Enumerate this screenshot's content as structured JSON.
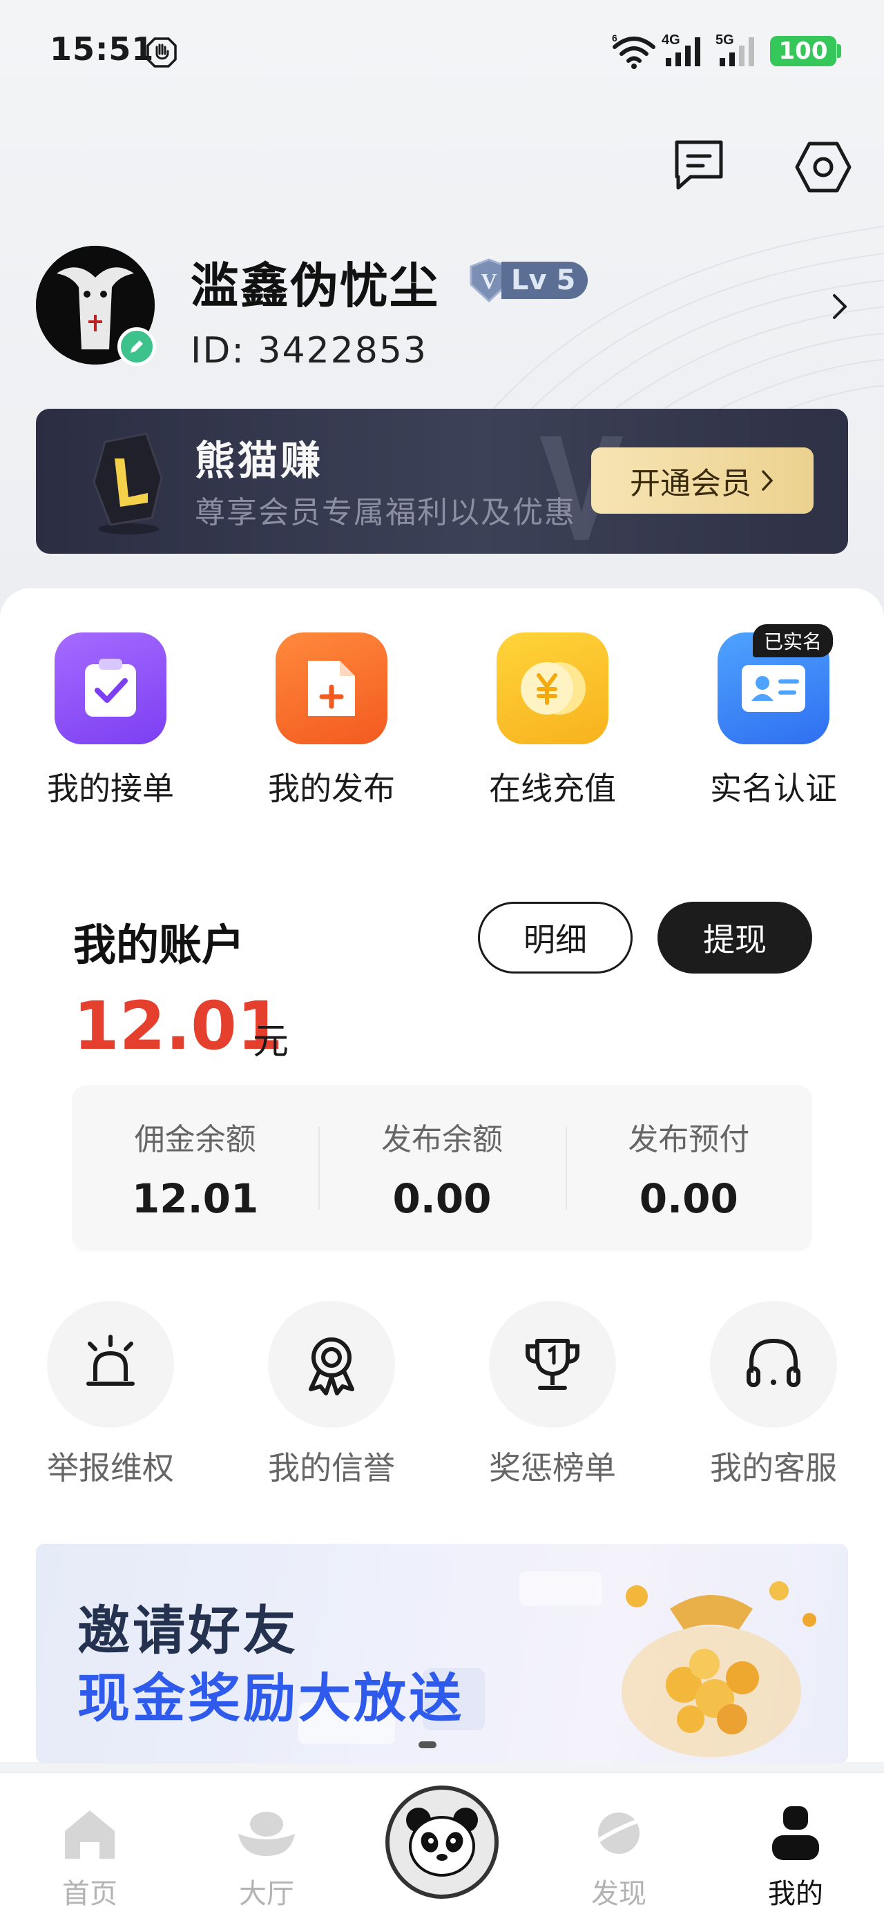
{
  "status_bar": {
    "time": "15:51",
    "network_1": "4G",
    "network_2": "5G",
    "battery": "100",
    "wifi_badge": "6"
  },
  "header": {
    "icons": [
      "message-icon",
      "settings-icon"
    ]
  },
  "profile": {
    "username": "滥鑫伪忧尘",
    "level": "Lv 5",
    "level_prefix": "V",
    "id_text": "ID:  3422853"
  },
  "vip": {
    "title": "熊猫赚",
    "subtitle": "尊享会员专属福利以及优惠",
    "button": "开通会员"
  },
  "quick_actions": [
    {
      "label": "我的接单",
      "icon": "clipboard-check-icon"
    },
    {
      "label": "我的发布",
      "icon": "document-add-icon"
    },
    {
      "label": "在线充值",
      "icon": "yuan-coin-icon"
    },
    {
      "label": "实名认证",
      "icon": "id-card-icon",
      "badge": "已实名"
    }
  ],
  "account": {
    "title": "我的账户",
    "detail_button": "明细",
    "withdraw_button": "提现",
    "balance": "12.01",
    "unit": "元",
    "breakdown": [
      {
        "label": "佣金余额",
        "value": "12.01"
      },
      {
        "label": "发布余额",
        "value": "0.00"
      },
      {
        "label": "发布预付",
        "value": "0.00"
      }
    ]
  },
  "services": [
    {
      "label": "举报维权",
      "icon": "alarm-icon"
    },
    {
      "label": "我的信誉",
      "icon": "award-ribbon-icon"
    },
    {
      "label": "奖惩榜单",
      "icon": "trophy-icon"
    },
    {
      "label": "我的客服",
      "icon": "headset-icon"
    }
  ],
  "invite_banner": {
    "line1": "邀请好友",
    "line2": "现金奖励大放送"
  },
  "bottom_nav": {
    "items": [
      {
        "label": "首页",
        "icon": "home-icon"
      },
      {
        "label": "大厅",
        "icon": "ingot-icon"
      },
      {
        "label": "",
        "icon": "panda-icon"
      },
      {
        "label": "发现",
        "icon": "planet-icon"
      },
      {
        "label": "我的",
        "icon": "person-icon"
      }
    ],
    "active": "我的"
  },
  "colors": {
    "accent_red": "#e53f2d",
    "vip_gold": "#ecd290",
    "invite_blue": "#2e5bec"
  }
}
